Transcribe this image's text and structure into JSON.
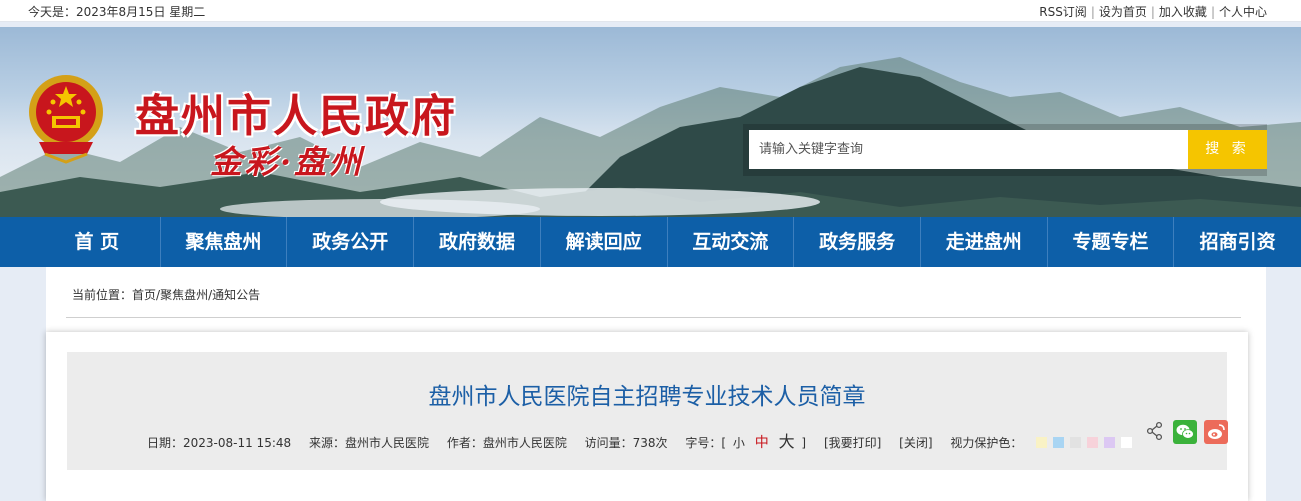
{
  "topbar": {
    "date": "今天是：2023年8月15日 星期二",
    "links": [
      "RSS订阅",
      "设为首页",
      "加入收藏",
      "个人中心"
    ]
  },
  "header": {
    "site_title": "盘州市人民政府",
    "slogan": "金彩·盘州"
  },
  "search": {
    "placeholder": "请输入关键字查询",
    "button_label": "搜 索"
  },
  "nav": {
    "items": [
      "首 页",
      "聚焦盘州",
      "政务公开",
      "政府数据",
      "解读回应",
      "互动交流",
      "政务服务",
      "走进盘州",
      "专题专栏",
      "招商引资"
    ]
  },
  "breadcrumb": {
    "label": "当前位置：",
    "path": [
      "首页",
      "聚焦盘州",
      "通知公告"
    ]
  },
  "article": {
    "title": "盘州市人民医院自主招聘专业技术人员简章",
    "date": "日期：2023-08-11 15:48",
    "source": "来源：盘州市人民医院",
    "author": "作者：盘州市人民医院",
    "views": "访问量：738次",
    "font_size_label": "字号：[",
    "font_small": "小",
    "font_mid": "中",
    "font_big": "大",
    "font_close": "]",
    "print_label": "[我要打印]",
    "close_label": "[关闭]",
    "eye_care_label": "视力保护色：",
    "eye_care_colors": [
      "#f9f2c5",
      "#a9d5f3",
      "#e2e2e2",
      "#f7d2da",
      "#dcc8f3",
      "#ffffff"
    ]
  },
  "colors": {
    "nav_bg": "#0d5fa8",
    "title_red": "#c8161d",
    "search_button": "#f5c500",
    "article_title": "#1c5fa6"
  },
  "icons": [
    "national-emblem",
    "share-icon",
    "wechat-icon",
    "weibo-icon"
  ]
}
